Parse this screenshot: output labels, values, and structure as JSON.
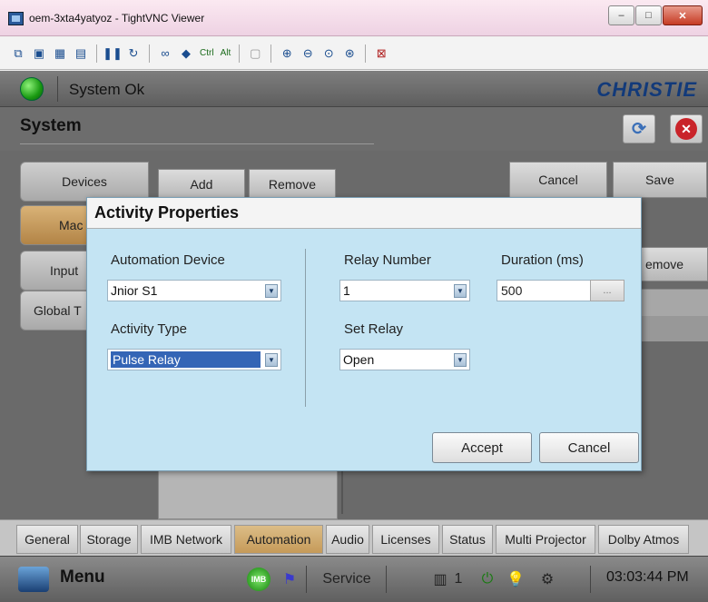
{
  "window": {
    "title": "oem-3xta4yatyoz - TightVNC Viewer",
    "minimize": "–",
    "maximize": "□",
    "close": "✕"
  },
  "toolbar": {
    "ctrl_label": "Ctrl",
    "alt_label": "Alt"
  },
  "app": {
    "status_text": "System Ok",
    "brand": "CHRISTIE",
    "page_title": "System",
    "status_color": "#1a9a12"
  },
  "left_tabs": [
    {
      "label": "Devices"
    },
    {
      "label": "Mac"
    },
    {
      "label": "Input"
    },
    {
      "label": "Global T"
    }
  ],
  "actions": {
    "add": "Add",
    "remove": "Remove",
    "cancel": "Cancel",
    "save": "Save",
    "remove_right": "emove"
  },
  "bottom_tabs": [
    {
      "label": "General"
    },
    {
      "label": "Storage"
    },
    {
      "label": "IMB Network"
    },
    {
      "label": "Automation"
    },
    {
      "label": "Audio"
    },
    {
      "label": "Licenses"
    },
    {
      "label": "Status"
    },
    {
      "label": "Multi Projector"
    },
    {
      "label": "Dolby Atmos"
    }
  ],
  "footer": {
    "menu": "Menu",
    "imb": "IMB",
    "service": "Service",
    "count": "1",
    "time": "03:03:44 PM"
  },
  "dialog": {
    "title": "Activity Properties",
    "automation_device_label": "Automation Device",
    "automation_device_value": "Jnior S1",
    "activity_type_label": "Activity Type",
    "activity_type_value": "Pulse Relay",
    "relay_number_label": "Relay Number",
    "relay_number_value": "1",
    "set_relay_label": "Set Relay",
    "set_relay_value": "Open",
    "duration_label": "Duration (ms)",
    "duration_value": "500",
    "ellipsis": "...",
    "accept": "Accept",
    "cancel": "Cancel"
  }
}
